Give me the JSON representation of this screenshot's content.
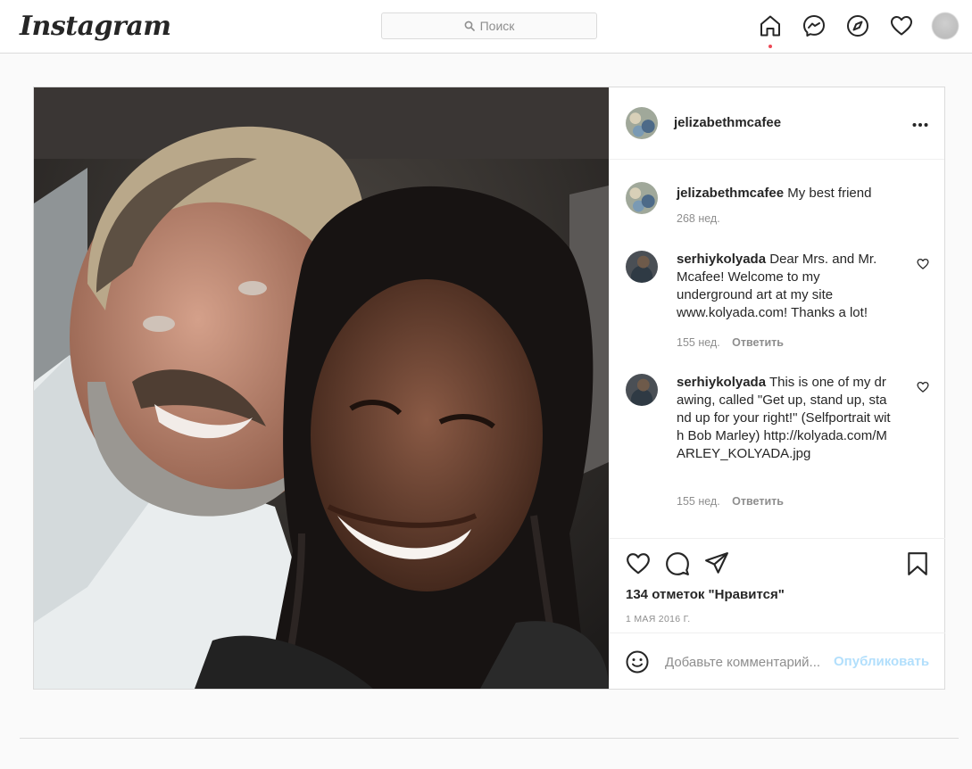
{
  "nav": {
    "logo": "Instagram",
    "search_placeholder": "Поиск",
    "icons": [
      "home-icon",
      "messenger-icon",
      "explore-icon",
      "activity-heart-icon",
      "profile-avatar"
    ],
    "notification_dot_color": "#ed4956"
  },
  "post": {
    "author": "jelizabethmcafee",
    "caption": {
      "username": "jelizabethmcafee",
      "text": "My best friend",
      "age": "268 нед."
    },
    "comments": [
      {
        "username": "serhiykolyada",
        "text": "Dear Mrs. and Mr. Mcafee! Welcome to my underground art at my site www.kolyada.com! Thanks a lot!",
        "age": "155 нед.",
        "reply_label": "Ответить"
      },
      {
        "username": "serhiykolyada",
        "text": "This is one of my drawing, called \"Get up, stand up, stand up for your right!\" (Selfportrait with Bob Marley) http://kolyada.com/MARLEY_KOLYADA.jpg",
        "age": "155 нед.",
        "reply_label": "Ответить"
      }
    ],
    "likes": "134 отметок \"Нравится\"",
    "date": "1 МАЯ 2016 Г.",
    "add_comment_placeholder": "Добавьте комментарий...",
    "publish_label": "Опубликовать",
    "publish_color": "#b2dffc"
  }
}
